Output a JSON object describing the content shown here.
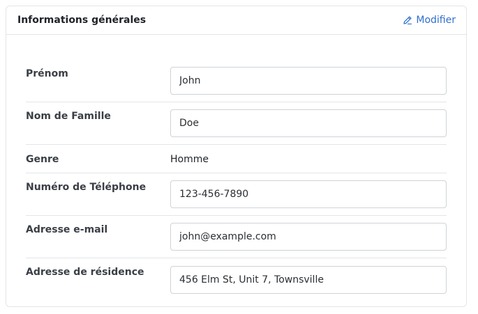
{
  "card": {
    "title": "Informations générales",
    "edit_label": "Modifier"
  },
  "fields": [
    {
      "label": "Prénom",
      "value": "John",
      "type": "input"
    },
    {
      "label": "Nom de Famille",
      "value": "Doe",
      "type": "input"
    },
    {
      "label": "Genre",
      "value": "Homme",
      "type": "static"
    },
    {
      "label": "Numéro de Téléphone",
      "value": "123-456-7890",
      "type": "input"
    },
    {
      "label": "Adresse e-mail",
      "value": "john@example.com",
      "type": "input"
    },
    {
      "label": "Adresse de résidence",
      "value": "456 Elm St, Unit 7, Townsville",
      "type": "input"
    }
  ],
  "colors": {
    "accent": "#2f6fd0",
    "border": "#e3e5e8"
  },
  "icons": {
    "edit": "pencil-icon"
  }
}
